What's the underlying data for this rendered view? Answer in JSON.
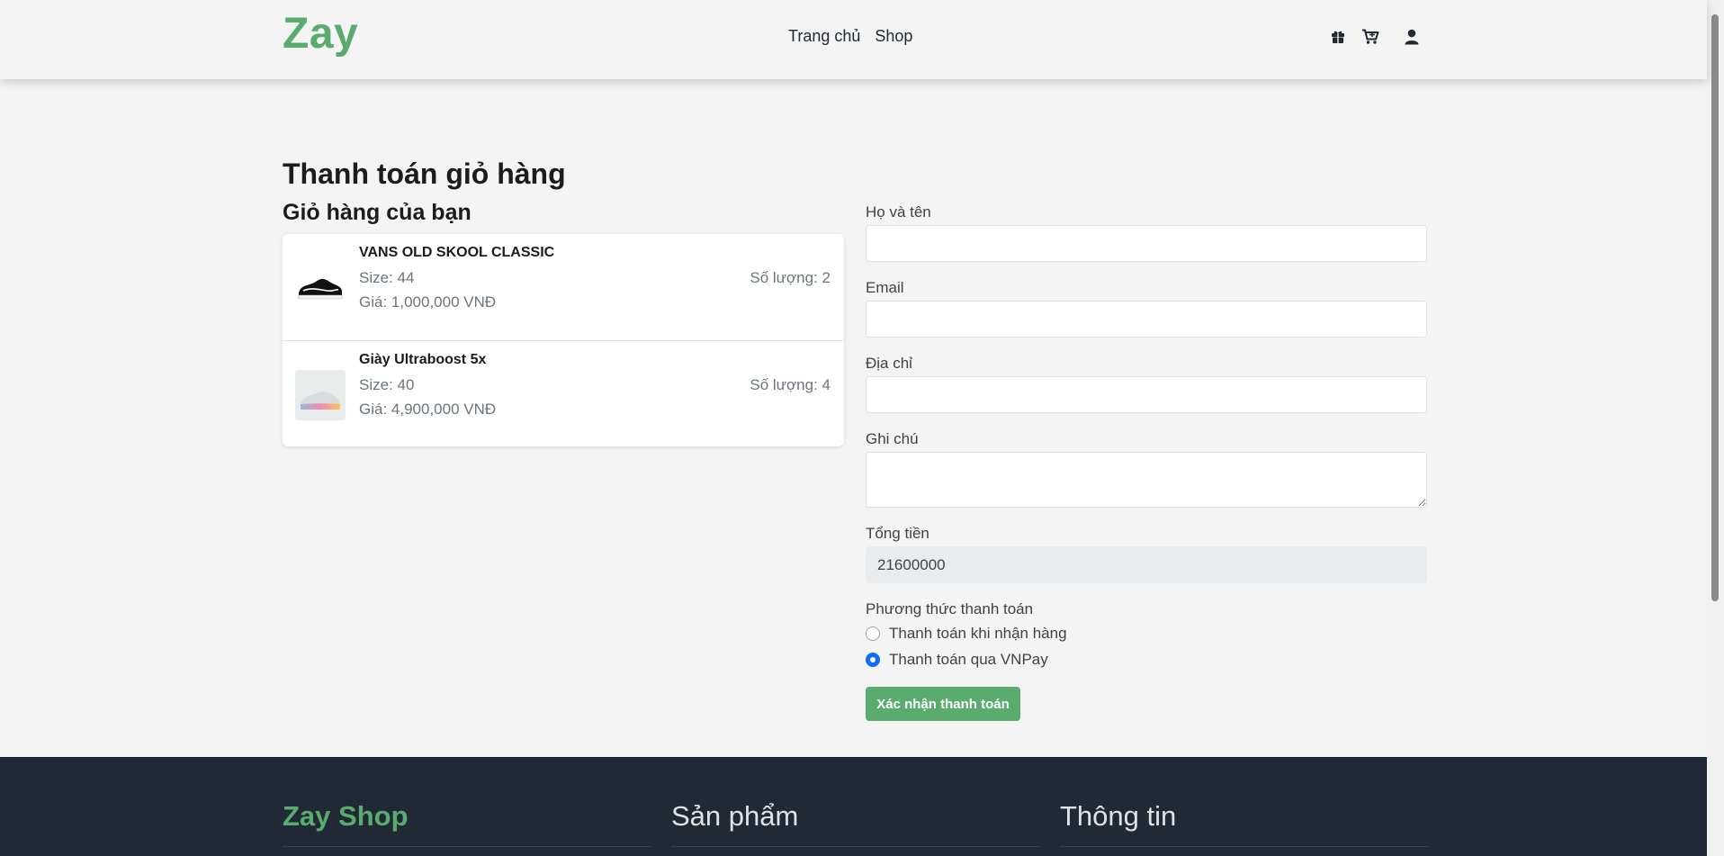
{
  "navbar": {
    "brand": "Zay",
    "links": [
      "Trang chủ",
      "Shop"
    ],
    "icons": [
      "gift-icon",
      "cart-icon",
      "user-icon"
    ]
  },
  "checkout": {
    "title": "Thanh toán giỏ hàng",
    "cart_title": "Giỏ hàng của bạn",
    "items": [
      {
        "name": "VANS OLD SKOOL CLASSIC",
        "size": "Size: 44",
        "price": "Giá: 1,000,000 VNĐ",
        "quantity": "Số lượng: 2"
      },
      {
        "name": "Giày Ultraboost 5x",
        "size": "Size: 40",
        "price": "Giá: 4,900,000 VNĐ",
        "quantity": "Số lượng: 4"
      }
    ]
  },
  "form": {
    "name_label": "Họ và tên",
    "name_value": "",
    "email_label": "Email",
    "email_value": "",
    "address_label": "Địa chỉ",
    "address_value": "",
    "note_label": "Ghi chú",
    "note_value": "",
    "total_label": "Tổng tiền",
    "total_value": "21600000",
    "payment_label": "Phương thức thanh toán",
    "payment_options": [
      {
        "label": "Thanh toán khi nhận hàng",
        "selected": false
      },
      {
        "label": "Thanh toán qua VNPay",
        "selected": true
      }
    ],
    "submit_label": "Xác nhận thanh toán"
  },
  "footer": {
    "brand": "Zay Shop",
    "products_title": "Sản phẩm",
    "info_title": "Thông tin"
  },
  "colors": {
    "brand_green": "#59ab6e",
    "footer_bg": "#212934",
    "radio_checked": "#0d6efd"
  }
}
